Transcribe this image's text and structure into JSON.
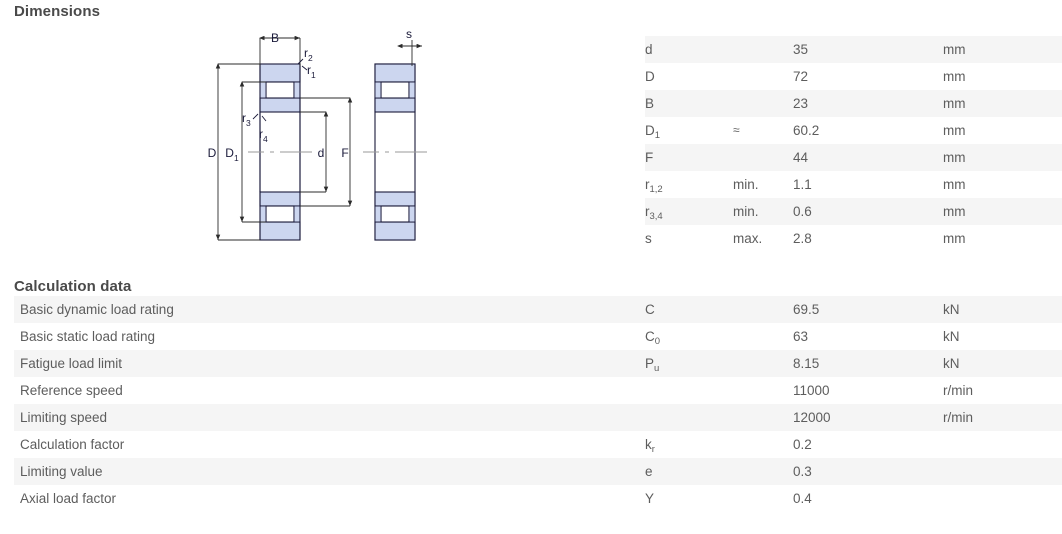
{
  "sections": {
    "dimensions_title": "Dimensions",
    "calculation_title": "Calculation data"
  },
  "dimensions_table": {
    "rows": [
      {
        "label": "",
        "symbol": "d",
        "sub": "",
        "qualifier": "",
        "value": "35",
        "unit": "mm"
      },
      {
        "label": "",
        "symbol": "D",
        "sub": "",
        "qualifier": "",
        "value": "72",
        "unit": "mm"
      },
      {
        "label": "",
        "symbol": "B",
        "sub": "",
        "qualifier": "",
        "value": "23",
        "unit": "mm"
      },
      {
        "label": "",
        "symbol": "D",
        "sub": "1",
        "qualifier": "≈",
        "value": "60.2",
        "unit": "mm"
      },
      {
        "label": "",
        "symbol": "F",
        "sub": "",
        "qualifier": "",
        "value": "44",
        "unit": "mm"
      },
      {
        "label": "",
        "symbol": "r",
        "sub": "1,2",
        "qualifier": "min.",
        "value": "1.1",
        "unit": "mm"
      },
      {
        "label": "",
        "symbol": "r",
        "sub": "3,4",
        "qualifier": "min.",
        "value": "0.6",
        "unit": "mm"
      },
      {
        "label": "",
        "symbol": "s",
        "sub": "",
        "qualifier": "max.",
        "value": "2.8",
        "unit": "mm"
      }
    ]
  },
  "calculation_table": {
    "rows": [
      {
        "label": "Basic dynamic load rating",
        "symbol": "C",
        "sub": "",
        "qualifier": "",
        "value": "69.5",
        "unit": "kN"
      },
      {
        "label": "Basic static load rating",
        "symbol": "C",
        "sub": "0",
        "qualifier": "",
        "value": "63",
        "unit": "kN"
      },
      {
        "label": "Fatigue load limit",
        "symbol": "P",
        "sub": "u",
        "qualifier": "",
        "value": "8.15",
        "unit": "kN"
      },
      {
        "label": "Reference speed",
        "symbol": "",
        "sub": "",
        "qualifier": "",
        "value": "11000",
        "unit": "r/min"
      },
      {
        "label": "Limiting speed",
        "symbol": "",
        "sub": "",
        "qualifier": "",
        "value": "12000",
        "unit": "r/min"
      },
      {
        "label": "Calculation factor",
        "symbol": "k",
        "sub": "r",
        "qualifier": "",
        "value": "0.2",
        "unit": ""
      },
      {
        "label": "Limiting value",
        "symbol": "e",
        "sub": "",
        "qualifier": "",
        "value": "0.3",
        "unit": ""
      },
      {
        "label": "Axial load factor",
        "symbol": "Y",
        "sub": "",
        "qualifier": "",
        "value": "0.4",
        "unit": ""
      }
    ]
  },
  "figure": {
    "labels": {
      "B": "B",
      "s": "s",
      "D": "D",
      "D1_base": "D",
      "D1_sub": "1",
      "d": "d",
      "F": "F",
      "r1_base": "r",
      "r1_sub": "1",
      "r2_base": "r",
      "r2_sub": "2",
      "r3_base": "r",
      "r3_sub": "3",
      "r4_base": "r",
      "r4_sub": "4"
    }
  },
  "colors": {
    "text": "#5d5d5d",
    "heading": "#4a4a4a",
    "row_shade": "#f5f5f5",
    "row_plain": "#ffffff",
    "drawing_line": "#1a1a3a",
    "drawing_fill": "#ccd6ef",
    "dimension_line": "#2b2b2b",
    "centerline": "#9a9a9a"
  }
}
